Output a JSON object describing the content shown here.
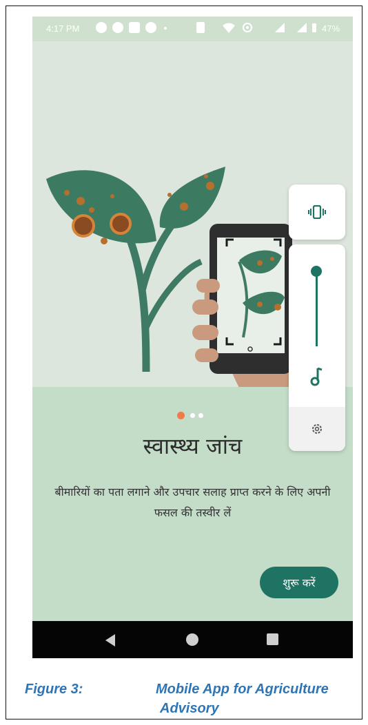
{
  "status_bar": {
    "time": "4:17 PM",
    "battery": "47%"
  },
  "onboarding": {
    "heading": "स्वास्थ्य जांच",
    "description": "बीमारियों का पता लगाने और उपचार सलाह प्राप्त करने के लिए अपनी फसल की तस्वीर लें",
    "start_button": "शुरू करें",
    "pager": {
      "total": 3,
      "active": 1
    }
  },
  "volume_panel": {
    "top_icon": "vibrate-icon",
    "level": 1.0,
    "stream_icon": "music-note-icon",
    "settings_icon": "gear-icon"
  },
  "colors": {
    "accent": "#1e7363",
    "active_dot": "#ef7a4a",
    "card_bg": "#c3ddc9",
    "caption": "#2e75b6"
  },
  "caption": {
    "label": "Figure 3:",
    "title_line1": "Mobile App for Agriculture",
    "title_line2": "Advisory"
  }
}
